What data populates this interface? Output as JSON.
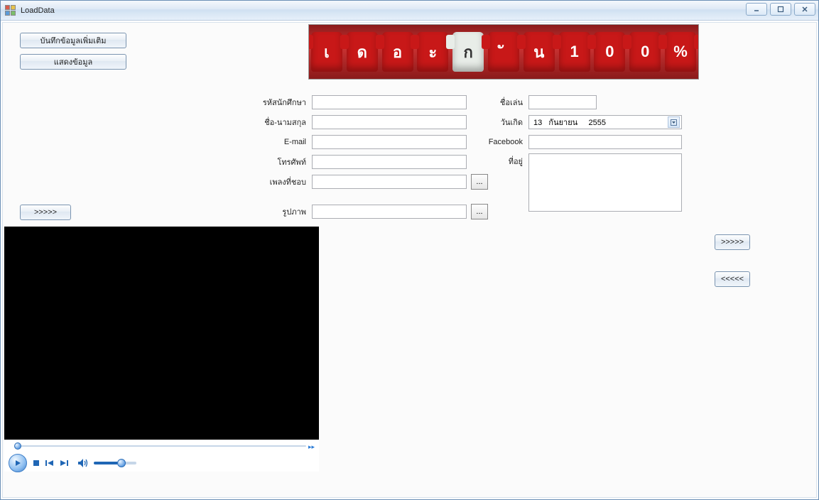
{
  "window": {
    "title": "LoadData"
  },
  "buttons": {
    "save_more": "บันทึกข้อมูลเพิ่มเติม",
    "show_data": "แสดงข้อมูล",
    "next": ">>>>>",
    "prev": "<<<<<"
  },
  "banner": {
    "chars": [
      "เ",
      "ด",
      "อ",
      "ะ",
      "ก",
      "ั",
      "น",
      "1",
      "0",
      "0",
      "%"
    ]
  },
  "labels": {
    "student_id": "รหัสนักศึกษา",
    "fullname": "ชื่อ-นามสกุล",
    "email": "E-mail",
    "phone": "โทรศัพท์",
    "fav_song": "เพลงที่ชอบ",
    "picture": "รูปภาพ",
    "nickname": "ชื่อเล่น",
    "birthdate": "วันเกิด",
    "facebook": "Facebook",
    "address": "ที่อยู่"
  },
  "values": {
    "student_id": "",
    "fullname": "",
    "email": "",
    "phone": "",
    "fav_song": "",
    "picture": "",
    "nickname": "",
    "birthdate_day": "13",
    "birthdate_month": "กันยายน",
    "birthdate_year": "2555",
    "facebook": "",
    "address": ""
  },
  "browse": {
    "label": "..."
  },
  "media": {
    "seek_end": "▸▸"
  }
}
